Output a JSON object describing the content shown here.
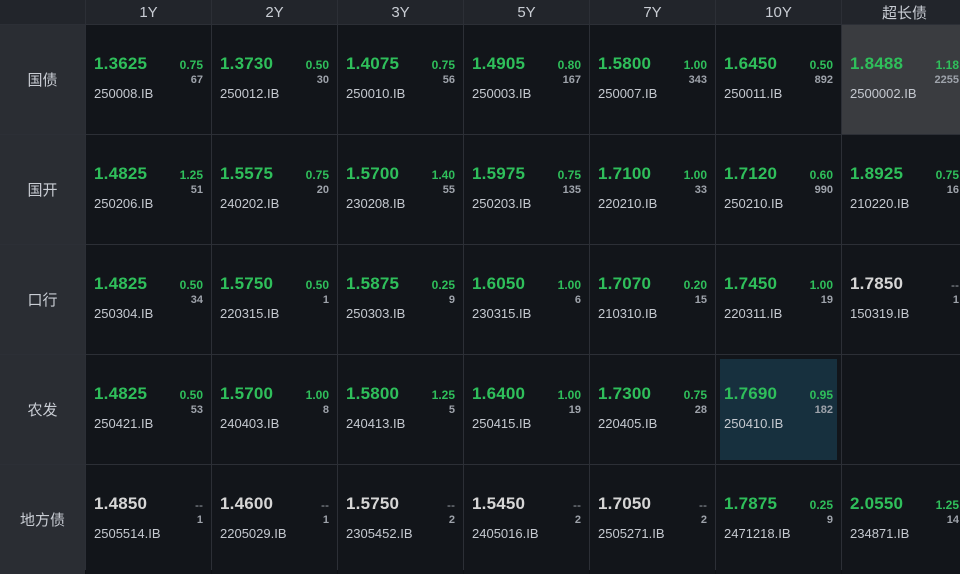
{
  "colors": {
    "up": "#2fbf5b",
    "flat": "#d6d6d6",
    "highlight_gray": "#3a3c40",
    "highlight_blue": "#17303e"
  },
  "columns": [
    "1Y",
    "2Y",
    "3Y",
    "5Y",
    "7Y",
    "10Y",
    "超长债"
  ],
  "rows": [
    {
      "label": "国债",
      "cells": [
        {
          "yield": "1.3625",
          "chg": "0.75",
          "vol": "67",
          "code": "250008.IB",
          "dir": "up"
        },
        {
          "yield": "1.3730",
          "chg": "0.50",
          "vol": "30",
          "code": "250012.IB",
          "dir": "up"
        },
        {
          "yield": "1.4075",
          "chg": "0.75",
          "vol": "56",
          "code": "250010.IB",
          "dir": "up"
        },
        {
          "yield": "1.4905",
          "chg": "0.80",
          "vol": "167",
          "code": "250003.IB",
          "dir": "up"
        },
        {
          "yield": "1.5800",
          "chg": "1.00",
          "vol": "343",
          "code": "250007.IB",
          "dir": "up"
        },
        {
          "yield": "1.6450",
          "chg": "0.50",
          "vol": "892",
          "code": "250011.IB",
          "dir": "up"
        },
        {
          "yield": "1.8488",
          "chg": "1.18",
          "vol": "2255",
          "code": "2500002.IB",
          "dir": "up",
          "highlight": "gray"
        }
      ]
    },
    {
      "label": "国开",
      "cells": [
        {
          "yield": "1.4825",
          "chg": "1.25",
          "vol": "51",
          "code": "250206.IB",
          "dir": "up"
        },
        {
          "yield": "1.5575",
          "chg": "0.75",
          "vol": "20",
          "code": "240202.IB",
          "dir": "up"
        },
        {
          "yield": "1.5700",
          "chg": "1.40",
          "vol": "55",
          "code": "230208.IB",
          "dir": "up"
        },
        {
          "yield": "1.5975",
          "chg": "0.75",
          "vol": "135",
          "code": "250203.IB",
          "dir": "up"
        },
        {
          "yield": "1.7100",
          "chg": "1.00",
          "vol": "33",
          "code": "220210.IB",
          "dir": "up"
        },
        {
          "yield": "1.7120",
          "chg": "0.60",
          "vol": "990",
          "code": "250210.IB",
          "dir": "up"
        },
        {
          "yield": "1.8925",
          "chg": "0.75",
          "vol": "16",
          "code": "210220.IB",
          "dir": "up"
        }
      ]
    },
    {
      "label": "口行",
      "cells": [
        {
          "yield": "1.4825",
          "chg": "0.50",
          "vol": "34",
          "code": "250304.IB",
          "dir": "up"
        },
        {
          "yield": "1.5750",
          "chg": "0.50",
          "vol": "1",
          "code": "220315.IB",
          "dir": "up"
        },
        {
          "yield": "1.5875",
          "chg": "0.25",
          "vol": "9",
          "code": "250303.IB",
          "dir": "up"
        },
        {
          "yield": "1.6050",
          "chg": "1.00",
          "vol": "6",
          "code": "230315.IB",
          "dir": "up"
        },
        {
          "yield": "1.7070",
          "chg": "0.20",
          "vol": "15",
          "code": "210310.IB",
          "dir": "up"
        },
        {
          "yield": "1.7450",
          "chg": "1.00",
          "vol": "19",
          "code": "220311.IB",
          "dir": "up"
        },
        {
          "yield": "1.7850",
          "chg": "--",
          "vol": "1",
          "code": "150319.IB",
          "dir": "flat"
        }
      ]
    },
    {
      "label": "农发",
      "cells": [
        {
          "yield": "1.4825",
          "chg": "0.50",
          "vol": "53",
          "code": "250421.IB",
          "dir": "up"
        },
        {
          "yield": "1.5700",
          "chg": "1.00",
          "vol": "8",
          "code": "240403.IB",
          "dir": "up"
        },
        {
          "yield": "1.5800",
          "chg": "1.25",
          "vol": "5",
          "code": "240413.IB",
          "dir": "up"
        },
        {
          "yield": "1.6400",
          "chg": "1.00",
          "vol": "19",
          "code": "250415.IB",
          "dir": "up"
        },
        {
          "yield": "1.7300",
          "chg": "0.75",
          "vol": "28",
          "code": "220405.IB",
          "dir": "up"
        },
        {
          "yield": "1.7690",
          "chg": "0.95",
          "vol": "182",
          "code": "250410.IB",
          "dir": "up",
          "highlight": "blue"
        },
        null
      ]
    },
    {
      "label": "地方债",
      "cells": [
        {
          "yield": "1.4850",
          "chg": "--",
          "vol": "1",
          "code": "2505514.IB",
          "dir": "flat"
        },
        {
          "yield": "1.4600",
          "chg": "--",
          "vol": "1",
          "code": "2205029.IB",
          "dir": "flat"
        },
        {
          "yield": "1.5750",
          "chg": "--",
          "vol": "2",
          "code": "2305452.IB",
          "dir": "flat"
        },
        {
          "yield": "1.5450",
          "chg": "--",
          "vol": "2",
          "code": "2405016.IB",
          "dir": "flat"
        },
        {
          "yield": "1.7050",
          "chg": "--",
          "vol": "2",
          "code": "2505271.IB",
          "dir": "flat"
        },
        {
          "yield": "1.7875",
          "chg": "0.25",
          "vol": "9",
          "code": "2471218.IB",
          "dir": "up"
        },
        {
          "yield": "2.0550",
          "chg": "1.25",
          "vol": "14",
          "code": "234871.IB",
          "dir": "up"
        }
      ]
    }
  ]
}
